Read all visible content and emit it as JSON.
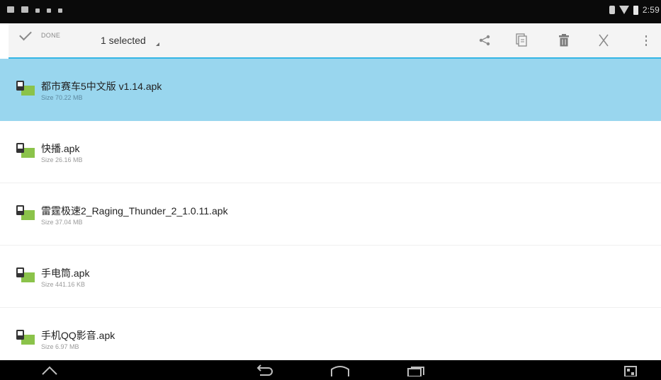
{
  "status_bar": {
    "time": "2:59",
    "left_icons": [
      "screenshot-icon",
      "image-icon",
      "usb-icon",
      "notification-dot-icon",
      "sd-card-icon"
    ],
    "right_icons": [
      "bluetooth-icon",
      "wifi-icon",
      "battery-icon"
    ]
  },
  "action_bar": {
    "done_label": "DONE",
    "selection_label": "1 selected",
    "actions": [
      "share-icon",
      "copy-icon",
      "delete-icon",
      "cut-icon",
      "overflow-menu-icon"
    ],
    "accent_color": "#33b5e5"
  },
  "files": [
    {
      "name": "都市赛车5中文版 v1.14.apk",
      "size": "Size 70.22 MB",
      "selected": true
    },
    {
      "name": "快播.apk",
      "size": "Size 26.16 MB",
      "selected": false
    },
    {
      "name": "雷霆极速2_Raging_Thunder_2_1.0.11.apk",
      "size": "Size 37.04 MB",
      "selected": false
    },
    {
      "name": "手电筒.apk",
      "size": "Size 441.16 KB",
      "selected": false
    },
    {
      "name": "手机QQ影音.apk",
      "size": "Size 6.97 MB",
      "selected": false
    }
  ],
  "nav_bar": {
    "buttons": [
      "hide-keyboard-icon",
      "back-icon",
      "home-icon",
      "recents-icon",
      "expand-icon"
    ]
  },
  "colors": {
    "selected_row": "#99d6ee",
    "apk_icon_green": "#8bc34a"
  }
}
